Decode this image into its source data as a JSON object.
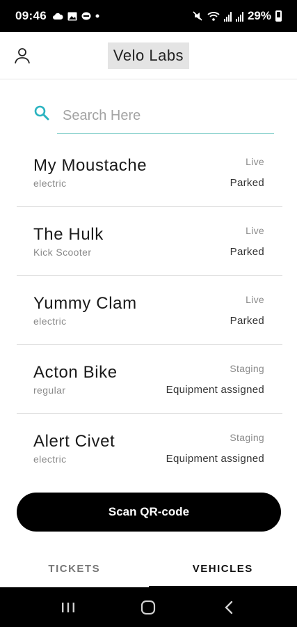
{
  "status_bar": {
    "time": "09:46",
    "battery": "29%",
    "icons_left": [
      "cloud-icon",
      "image-icon",
      "messenger-icon",
      "dot-icon"
    ],
    "icons_right": [
      "mute-icon",
      "wifi-icon",
      "signal-icon",
      "signal-icon",
      "battery-icon"
    ]
  },
  "header": {
    "title": "Velo Labs",
    "profile_icon": "person-icon"
  },
  "search": {
    "placeholder": "Search Here",
    "value": "",
    "icon": "search-icon"
  },
  "vehicles": [
    {
      "name": "My Moustache",
      "type": "electric",
      "status": "Live",
      "state": "Parked"
    },
    {
      "name": "The Hulk",
      "type": "Kick Scooter",
      "status": "Live",
      "state": "Parked"
    },
    {
      "name": "Yummy Clam",
      "type": "electric",
      "status": "Live",
      "state": "Parked"
    },
    {
      "name": "Acton Bike",
      "type": "regular",
      "status": "Staging",
      "state": "Equipment assigned"
    },
    {
      "name": "Alert Civet",
      "type": "electric",
      "status": "Staging",
      "state": "Equipment assigned"
    }
  ],
  "scan_button": {
    "label": "Scan QR-code"
  },
  "tabs": [
    {
      "label": "TICKETS",
      "active": false
    },
    {
      "label": "VEHICLES",
      "active": true
    }
  ],
  "nav_bar": {
    "buttons": [
      "recent-apps-icon",
      "home-icon",
      "back-icon"
    ]
  },
  "colors": {
    "accent": "#2ab3c0",
    "search_underline": "#8fd3cf",
    "button_bg": "#000000",
    "status_bar_bg": "#000000"
  }
}
